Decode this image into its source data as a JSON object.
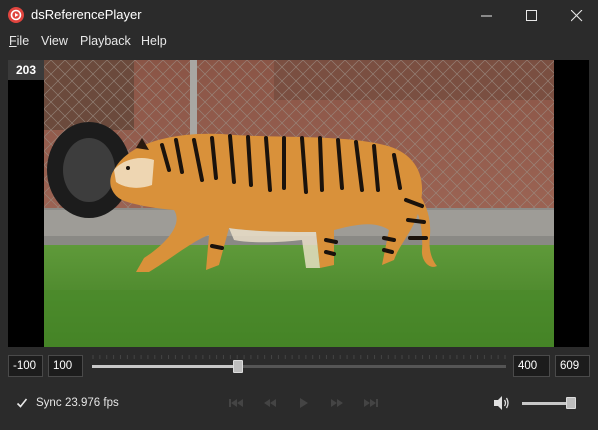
{
  "window": {
    "title": "dsReferencePlayer",
    "accent_color": "#e0443e"
  },
  "menu": {
    "file_first": "F",
    "file_rest": "ile",
    "view": "View",
    "playback": "Playback",
    "help": "Help"
  },
  "video": {
    "frame_number": "203"
  },
  "timeline": {
    "min": "-100",
    "start": "100",
    "end": "400",
    "max": "609",
    "position_fraction": 0.35
  },
  "status": {
    "sync_label": "Sync",
    "sync_checked": true,
    "fps": "23.976 fps"
  },
  "transport": {
    "icons": [
      "skip-to-start-icon",
      "step-back-icon",
      "play-icon",
      "step-forward-icon",
      "skip-to-end-icon"
    ]
  },
  "volume": {
    "icon": "speaker-icon",
    "level_fraction": 0.95
  }
}
